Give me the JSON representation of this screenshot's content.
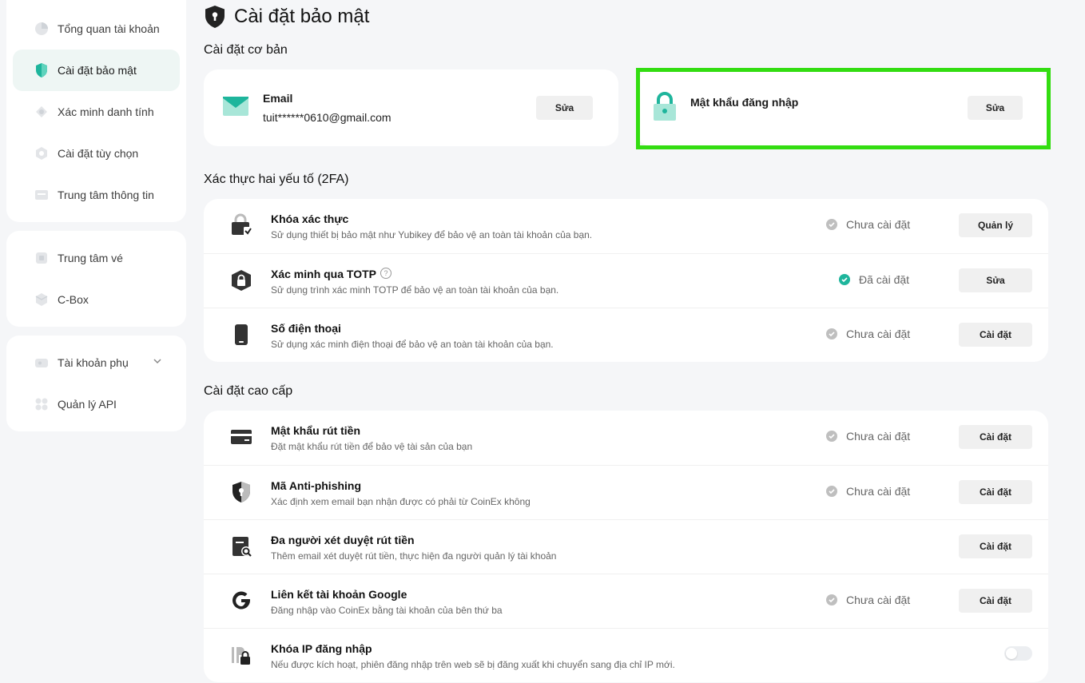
{
  "colors": {
    "accent": "#1eb59c",
    "highlight": "#33dd11",
    "muted_status": "#bfbfbf"
  },
  "sidebar": {
    "groups": [
      [
        {
          "label": "Tổng quan tài khoản",
          "icon": "pie-chart-icon"
        },
        {
          "label": "Cài đặt bảo mật",
          "icon": "shield-icon",
          "active": true
        },
        {
          "label": "Xác minh danh tính",
          "icon": "id-badge-icon"
        },
        {
          "label": "Cài đặt tùy chọn",
          "icon": "settings-icon"
        },
        {
          "label": "Trung tâm thông tin",
          "icon": "message-icon"
        }
      ],
      [
        {
          "label": "Trung tâm vé",
          "icon": "ticket-icon"
        },
        {
          "label": "C-Box",
          "icon": "box-icon"
        }
      ],
      [
        {
          "label": "Tài khoản phụ",
          "icon": "sub-account-icon",
          "has_chevron": true
        },
        {
          "label": "Quản lý API",
          "icon": "api-icon"
        }
      ]
    ]
  },
  "page": {
    "title": "Cài đặt bảo mật"
  },
  "basic": {
    "title": "Cài đặt cơ bản",
    "email": {
      "label": "Email",
      "value": "tuit******0610@gmail.com",
      "button": "Sửa"
    },
    "password": {
      "label": "Mật khẩu đăng nhập",
      "button": "Sửa"
    }
  },
  "twofa": {
    "title": "Xác thực hai yếu tố (2FA)",
    "rows": [
      {
        "title": "Khóa xác thực",
        "desc": "Sử dụng thiết bị bảo mật như Yubikey để bảo vệ an toàn tài khoản của bạn.",
        "status": "Chưa cài đặt",
        "done": false,
        "button": "Quản lý",
        "icon": "security-key-icon"
      },
      {
        "title": "Xác minh qua TOTP",
        "desc": "Sử dụng trình xác minh TOTP để bảo vệ an toàn tài khoản của bạn.",
        "status": "Đã cài đặt",
        "done": true,
        "button": "Sửa",
        "icon": "totp-lock-icon",
        "help": "?"
      },
      {
        "title": "Số điện thoại",
        "desc": "Sử dụng xác minh điện thoại để bảo vệ an toàn tài khoản của bạn.",
        "status": "Chưa cài đặt",
        "done": false,
        "button": "Cài đặt",
        "icon": "phone-icon"
      }
    ]
  },
  "advanced": {
    "title": "Cài đặt cao cấp",
    "rows": [
      {
        "title": "Mật khẩu rút tiền",
        "desc": "Đặt mật khẩu rút tiền để bảo vệ tài sản của bạn",
        "status": "Chưa cài đặt",
        "done": false,
        "button": "Cài đặt",
        "icon": "card-icon"
      },
      {
        "title": "Mã Anti-phishing",
        "desc": "Xác định xem email bạn nhận được có phải từ CoinEx không",
        "status": "Chưa cài đặt",
        "done": false,
        "button": "Cài đặt",
        "icon": "anti-phishing-shield-icon"
      },
      {
        "title": "Đa người xét duyệt rút tiền",
        "desc": "Thêm email xét duyệt rút tiền, thực hiện đa người quản lý tài khoản",
        "status": "",
        "done": false,
        "button": "Cài đặt",
        "icon": "document-search-icon"
      },
      {
        "title": "Liên kết tài khoản Google",
        "desc": "Đăng nhập vào CoinEx bằng tài khoản của bên thứ ba",
        "status": "Chưa cài đặt",
        "done": false,
        "button": "Cài đặt",
        "icon": "google-icon"
      },
      {
        "title": "Khóa IP đăng nhập",
        "desc": "Nếu được kích hoạt, phiên đăng nhập trên web sẽ bị đăng xuất khi chuyển sang địa chỉ IP mới.",
        "status": "",
        "done": false,
        "toggle": false,
        "icon": "ip-lock-icon"
      }
    ]
  }
}
